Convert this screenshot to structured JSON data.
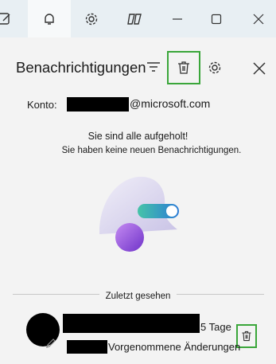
{
  "window": {
    "tabs": [
      {
        "icon": "edit-board-icon"
      },
      {
        "icon": "bell-icon",
        "active": true
      },
      {
        "icon": "gear-icon"
      },
      {
        "icon": "copilot-icon"
      }
    ],
    "controls": [
      "minimize-icon",
      "maximize-icon",
      "close-icon"
    ]
  },
  "panel": {
    "title": "Benachrichtigungen",
    "account_label": "Konto:",
    "account_suffix": "@microsoft.com",
    "empty_title": "Sie sind alle aufgeholt!",
    "empty_subtitle": "Sie haben keine neuen Benachrichtigungen.",
    "recent_header": "Zuletzt gesehen",
    "recent_item": {
      "time": "5 Tage",
      "description": "Vorgenommene Änderungen"
    }
  },
  "colors": {
    "highlight": "#3aa63a",
    "topbar": "#e8eff3",
    "panel": "#f3f3f3"
  }
}
